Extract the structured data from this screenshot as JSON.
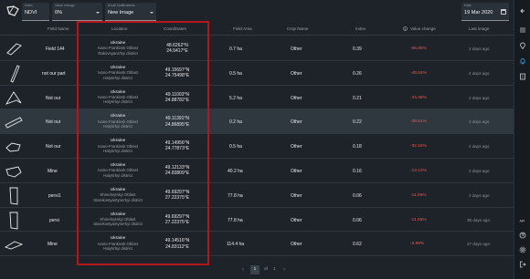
{
  "filters": {
    "index": {
      "caption": "Index",
      "value": "NDVI"
    },
    "value_change": {
      "caption": "Value change",
      "value": "0%"
    },
    "email_notifications": {
      "caption": "Email Notifications",
      "value": "New Image"
    },
    "date": {
      "caption": "Date",
      "value": "19 Mar 2020"
    }
  },
  "table": {
    "headers": {
      "field_name": "Field Name",
      "location": "Location",
      "coordinates": "Coordinates",
      "field_area": "Field Area",
      "crop_name": "Crop Name",
      "index": "Index",
      "value_change": "Value change",
      "last_image": "Last image"
    },
    "rows": [
      {
        "name": "Field 144",
        "country": "Ukraine",
        "oblast": "Ivano-Frankivsk Oblast",
        "district": "Rakovnyans'kyi district",
        "lat": "48.6262°N",
        "lon": "24.5417°E",
        "area": "0.7 ha",
        "crop": "Other",
        "index": "0.39",
        "change": "-95.85%",
        "last": "2 days ago"
      },
      {
        "name": "not our part",
        "country": "Ukraine",
        "oblast": "Ivano-Frankivsk Oblast",
        "district": "Halyts'kyi district",
        "lat": "49.15697°N",
        "lon": "24.75498°E",
        "area": "0.5 ha",
        "crop": "Other",
        "index": "0.26",
        "change": "-48.53%",
        "last": "2 days ago"
      },
      {
        "name": "Not our",
        "country": "Ukraine",
        "oblast": "Ivano-Frankivsk Oblast",
        "district": "Halyts'kyi district",
        "lat": "49.11003°N",
        "lon": "24.88782°E",
        "area": "5.2 ha",
        "crop": "Other",
        "index": "0.21",
        "change": "-44.48%",
        "last": "2 days ago"
      },
      {
        "name": "Not our",
        "country": "Ukraine",
        "oblast": "Ivano-Frankivsk Oblast",
        "district": "Halyts'kyi district",
        "lat": "49.11391°N",
        "lon": "24.86895°E",
        "area": "0.2 ha",
        "crop": "Other",
        "index": "0.22",
        "change": "-38.51%",
        "last": "2 days ago"
      },
      {
        "name": "Not our",
        "country": "Ukraine",
        "oblast": "Ivano-Frankivsk Oblast",
        "district": "Halyts'kyi district",
        "lat": "49.14956°N",
        "lon": "24.77873°E",
        "area": "0.5 ha",
        "crop": "Other",
        "index": "0.18",
        "change": "-32.15%",
        "last": "2 days ago"
      },
      {
        "name": "Mine",
        "country": "Ukraine",
        "oblast": "Ivano-Frankivsk Oblast",
        "district": "Halyts'kyi district",
        "lat": "49.12133°N",
        "lon": "24.83809°E",
        "area": "40.2 ha",
        "crop": "Other",
        "index": "0.16",
        "change": "-14.13%",
        "last": "2 days ago"
      },
      {
        "name": "persi1",
        "country": "Ukraine",
        "oblast": "Khmelnytskyi Oblast",
        "district": "Starokostyantyniv'kyi district",
        "lat": "49.69297°N",
        "lon": "27.22375°E",
        "area": "77.8 ha",
        "crop": "Other",
        "index": "0.06",
        "change": "-11.05%",
        "last": "2 days ago"
      },
      {
        "name": "persi",
        "country": "Ukraine",
        "oblast": "Khmelnytskyi Oblast",
        "district": "Starokostyantyniv'kyi district",
        "lat": "49.69297°N",
        "lon": "27.22375°E",
        "area": "77.8 ha",
        "crop": "Other",
        "index": "0.06",
        "change": "-11.05%",
        "last": "35 days ago"
      },
      {
        "name": "Mine",
        "country": "Ukraine",
        "oblast": "Ivano-Frankivsk Oblast",
        "district": "Halyts'kyi district",
        "lat": "49.14516°N",
        "lon": "24.83112°E",
        "area": "114.4 ha",
        "crop": "Other",
        "index": "0.62",
        "change": "-5.69%",
        "last": "27 days ago"
      }
    ]
  },
  "pagination": {
    "current": "1",
    "of_label": "of",
    "total": "1"
  },
  "colors": {
    "accent": "#2c93d4",
    "negative": "#e8594f",
    "highlight": "#b5161a"
  }
}
